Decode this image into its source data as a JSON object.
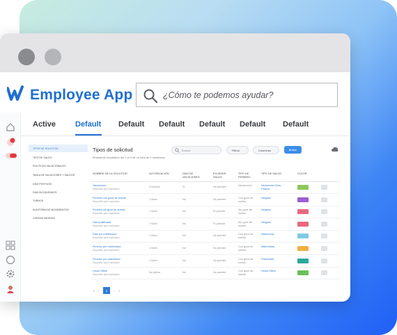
{
  "app": {
    "title": "Employee App",
    "search_placeholder": "¿Cómo te podemos ayudar?"
  },
  "tabs": [
    "Active",
    "Default",
    "Default",
    "Default",
    "Default",
    "Default",
    "Default"
  ],
  "leftbar": {
    "badge1": "1",
    "badge2": "100"
  },
  "submenu": [
    "TIPOS DE SOLICITUD",
    "TIPO DE SALDO",
    "POLÍTICAS VACACIONALES",
    "TABLA DE VACACIONES Y SALDOS",
    "DÍAS FESTIVOS",
    "DÍAS BLOQUEADOS",
    "TURNOS",
    "AUDITORÍA DE MOVIMIENTOS",
    "CARGAS MASIVAS"
  ],
  "content": {
    "title": "Tipos de solicitud",
    "subtitle": "Mostrando resultados del 1 al 9 de un total de 9 resultados",
    "search": "Buscar",
    "filters": "Filtros",
    "columns": "Columnas",
    "button": "Button"
  },
  "table": {
    "headers": [
      "NOMBRE DE LA SOLICITUD",
      "AUTORIZACIÓN",
      "DÍAS DE VACACIONES",
      "EXCEDER SALDO",
      "TIPO DE PERMISO",
      "TIPO DE SALDO",
      "COLOR"
    ],
    "rows": [
      {
        "name": "Vacaciones",
        "sub": "Disponible para empleados",
        "auth": "2 Niveles",
        "days": "Sí",
        "exceed": "No permite",
        "perm": "Vacaciones",
        "saldo": "Vacaciones Días Festivo",
        "color": "#8cc85a"
      },
      {
        "name": "Permiso con goce de sueldo",
        "sub": "Disponible para empleados",
        "auth": "1 Nivel",
        "days": "No",
        "exceed": "No permite",
        "perm": "Con goce de sueldo",
        "saldo": "Ninguno",
        "color": "#9b5fd0"
      },
      {
        "name": "Permiso sin goce de sueldo",
        "sub": "Disponible para empleados",
        "auth": "1 Nivel",
        "days": "No",
        "exceed": "Sí permite",
        "perm": "Sin goce de sueldo",
        "saldo": "Ninguno",
        "color": "#e8687c"
      },
      {
        "name": "Falta justificada",
        "sub": "Disponible para empleados",
        "auth": "1 Nivel",
        "days": "No",
        "exceed": "Sí permite",
        "perm": "Sin goce de sueldo",
        "saldo": "Ninguno",
        "color": "#e8687c"
      },
      {
        "name": "Días por matrimonio",
        "sub": "Disponible para empleados",
        "auth": "1 Nivel",
        "days": "No",
        "exceed": "No permite",
        "perm": "Con goce de sueldo",
        "saldo": "Matrimonio",
        "color": "#7ecbe0"
      },
      {
        "name": "Permiso por maternidad",
        "sub": "Disponible para empleados",
        "auth": "1 Nivel",
        "days": "No",
        "exceed": "No permite",
        "perm": "Con goce de sueldo",
        "saldo": "Maternidad",
        "color": "#f0b040"
      },
      {
        "name": "Permiso por paternidad",
        "sub": "Disponible para empleados",
        "auth": "1 Nivel",
        "days": "No",
        "exceed": "No permite",
        "perm": "Con goce de sueldo",
        "saldo": "Paternidad",
        "color": "#2aa89a"
      },
      {
        "name": "Home Office",
        "sub": "Disponible para empleados",
        "auth": "No Aplica",
        "days": "No",
        "exceed": "No permite",
        "perm": "Con goce de sueldo",
        "saldo": "Home Office",
        "color": "#6cc05a"
      }
    ]
  },
  "pager": {
    "prev": "«",
    "prev2": "‹",
    "current": "1",
    "next": "›",
    "next2": "»"
  },
  "colors": {
    "accent": "#1f6fd0"
  }
}
